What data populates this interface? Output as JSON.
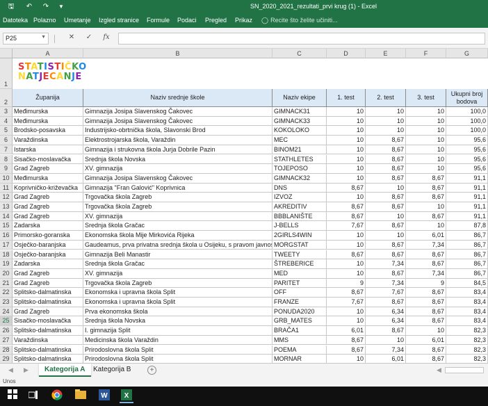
{
  "window": {
    "title": "SN_2020_2021_rezultati_prvi krug (1)  -  Excel"
  },
  "ribbon_tabs": [
    "Datoteka",
    "Polazno",
    "Umetanje",
    "Izgled stranice",
    "Formule",
    "Podaci",
    "Pregled",
    "Prikaz"
  ],
  "tell_me": "Recite što želite učiniti...",
  "name_box": "P25",
  "formula_value": "",
  "columns": [
    "A",
    "B",
    "C",
    "D",
    "E",
    "F",
    "G"
  ],
  "logo": {
    "line1": "STATISTIČKO",
    "line2": "NATJECANJE"
  },
  "headers": [
    "Županija",
    "Naziv srednje škole",
    "Naziv ekipe",
    "1. test",
    "2. test",
    "3. test",
    "Ukupni broj bodova"
  ],
  "rows": [
    {
      "n": "3",
      "zup": "Međimurska",
      "skola": "Gimnazija Josipa Slavenskog Čakovec",
      "ekipa": "GIMNACK31",
      "t1": "10",
      "t2": "10",
      "t3": "10",
      "uk": "100,0"
    },
    {
      "n": "4",
      "zup": "Međimurska",
      "skola": "Gimnazija Josipa Slavenskog Čakovec",
      "ekipa": "GIMNACK33",
      "t1": "10",
      "t2": "10",
      "t3": "10",
      "uk": "100,0"
    },
    {
      "n": "5",
      "zup": "Brodsko-posavska",
      "skola": "Industrijsko-obrtnička škola, Slavonski Brod",
      "ekipa": "KOKOLOKO",
      "t1": "10",
      "t2": "10",
      "t3": "10",
      "uk": "100,0"
    },
    {
      "n": "6",
      "zup": "Varaždinska",
      "skola": "Elektrostrojarska škola, Varaždin",
      "ekipa": "MEC",
      "t1": "10",
      "t2": "8,67",
      "t3": "10",
      "uk": "95,6"
    },
    {
      "n": "7",
      "zup": "Istarska",
      "skola": "Gimnazija i strukovna škola Jurja Dobrile Pazin",
      "ekipa": "BINOM21",
      "t1": "10",
      "t2": "8,67",
      "t3": "10",
      "uk": "95,6"
    },
    {
      "n": "8",
      "zup": "Sisačko-moslavačka",
      "skola": "Srednja škola Novska",
      "ekipa": "STATHLETES",
      "t1": "10",
      "t2": "8,67",
      "t3": "10",
      "uk": "95,6"
    },
    {
      "n": "9",
      "zup": "Grad Zagreb",
      "skola": "XV. gimnazija",
      "ekipa": "TOJEPOSO",
      "t1": "10",
      "t2": "8,67",
      "t3": "10",
      "uk": "95,6"
    },
    {
      "n": "10",
      "zup": "Međimurska",
      "skola": "Gimnazija Josipa Slavenskog Čakovec",
      "ekipa": "GIMNACK32",
      "t1": "10",
      "t2": "8,67",
      "t3": "8,67",
      "uk": "91,1"
    },
    {
      "n": "11",
      "zup": "Koprivničko-križevačka",
      "skola": "Gimnazija \"Fran Galović\" Koprivnica",
      "ekipa": "DNS",
      "t1": "8,67",
      "t2": "10",
      "t3": "8,67",
      "uk": "91,1"
    },
    {
      "n": "12",
      "zup": "Grad Zagreb",
      "skola": "Trgovačka škola Zagreb",
      "ekipa": "IZVOZ",
      "t1": "10",
      "t2": "8,67",
      "t3": "8,67",
      "uk": "91,1"
    },
    {
      "n": "13",
      "zup": "Grad Zagreb",
      "skola": "Trgovačka škola Zagreb",
      "ekipa": "AKREDITIV",
      "t1": "8,67",
      "t2": "8,67",
      "t3": "10",
      "uk": "91,1"
    },
    {
      "n": "14",
      "zup": "Grad Zagreb",
      "skola": "XV. gimnazija",
      "ekipa": "BBBLANIŠTE",
      "t1": "8,67",
      "t2": "10",
      "t3": "8,67",
      "uk": "91,1"
    },
    {
      "n": "15",
      "zup": "Zadarska",
      "skola": "Srednja škola Gračac",
      "ekipa": "J-BELLS",
      "t1": "7,67",
      "t2": "8,67",
      "t3": "10",
      "uk": "87,8"
    },
    {
      "n": "16",
      "zup": "Primorsko-goranska",
      "skola": "Ekonomska škola Mije Mirkovića Rijeka",
      "ekipa": "2GIRLS4WIN",
      "t1": "10",
      "t2": "10",
      "t3": "6,01",
      "uk": "86,7"
    },
    {
      "n": "17",
      "zup": "Osječko-baranjska",
      "skola": "Gaudeamus, prva privatna srednja škola u Osijeku, s pravom javnosti",
      "ekipa": "MORGSTAT",
      "t1": "10",
      "t2": "8,67",
      "t3": "7,34",
      "uk": "86,7"
    },
    {
      "n": "18",
      "zup": "Osječko-baranjska",
      "skola": "Gimnazija Beli Manastir",
      "ekipa": "TWEETY",
      "t1": "8,67",
      "t2": "8,67",
      "t3": "8,67",
      "uk": "86,7"
    },
    {
      "n": "19",
      "zup": "Zadarska",
      "skola": "Srednja škola Gračac",
      "ekipa": "ŠTREBERICE",
      "t1": "10",
      "t2": "7,34",
      "t3": "8,67",
      "uk": "86,7"
    },
    {
      "n": "20",
      "zup": "Grad Zagreb",
      "skola": "XV. gimnazija",
      "ekipa": "MED",
      "t1": "10",
      "t2": "8,67",
      "t3": "7,34",
      "uk": "86,7"
    },
    {
      "n": "21",
      "zup": "Grad Zagreb",
      "skola": "Trgovačka škola Zagreb",
      "ekipa": "PARITET",
      "t1": "9",
      "t2": "7,34",
      "t3": "9",
      "uk": "84,5"
    },
    {
      "n": "22",
      "zup": "Splitsko-dalmatinska",
      "skola": "Ekonomska i upravna škola Split",
      "ekipa": "OFF",
      "t1": "8,67",
      "t2": "7,67",
      "t3": "8,67",
      "uk": "83,4"
    },
    {
      "n": "23",
      "zup": "Splitsko-dalmatinska",
      "skola": "Ekonomska i upravna škola Split",
      "ekipa": "FRANZE",
      "t1": "7,67",
      "t2": "8,67",
      "t3": "8,67",
      "uk": "83,4"
    },
    {
      "n": "24",
      "zup": "Grad Zagreb",
      "skola": "Prva ekonomska škola",
      "ekipa": "PONUDA2020",
      "t1": "10",
      "t2": "6,34",
      "t3": "8,67",
      "uk": "83,4"
    },
    {
      "n": "25",
      "zup": "Sisačko-moslavačka",
      "skola": "Srednja škola Novska",
      "ekipa": "GRB_MATES",
      "t1": "10",
      "t2": "6,34",
      "t3": "8,67",
      "uk": "83,4"
    },
    {
      "n": "26",
      "zup": "Splitsko-dalmatinska",
      "skola": "I. gimnazija Split",
      "ekipa": "BRAČA1",
      "t1": "6,01",
      "t2": "8,67",
      "t3": "10",
      "uk": "82,3"
    },
    {
      "n": "27",
      "zup": "Varaždinska",
      "skola": "Medicinska škola Varaždin",
      "ekipa": "MMS",
      "t1": "8,67",
      "t2": "10",
      "t3": "6,01",
      "uk": "82,3"
    },
    {
      "n": "28",
      "zup": "Splitsko-dalmatinska",
      "skola": "Prirodoslovna škola Split",
      "ekipa": "POEMA",
      "t1": "8,67",
      "t2": "7,34",
      "t3": "8,67",
      "uk": "82,3"
    },
    {
      "n": "29",
      "zup": "Splitsko-dalmatinska",
      "skola": "Prirodoslovna škola Split",
      "ekipa": "MORNAR",
      "t1": "10",
      "t2": "6,01",
      "t3": "8,67",
      "uk": "82,3"
    }
  ],
  "sheets": [
    "Kategorija A",
    "Kategorija B"
  ],
  "active_sheet": "Kategorija A",
  "status": "Unos",
  "colors": {
    "excel_green": "#217346",
    "header_fill": "#dbe8f6"
  },
  "taskbar_icons": [
    "windows-start-icon",
    "task-view-icon",
    "chrome-icon",
    "file-explorer-icon",
    "word-icon",
    "excel-icon"
  ]
}
